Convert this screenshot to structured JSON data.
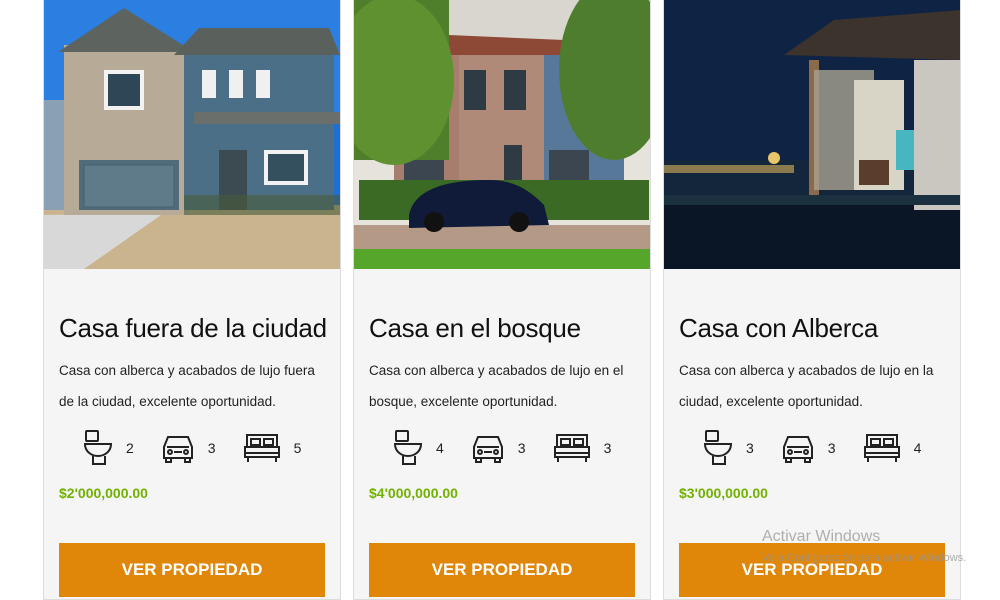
{
  "listings": [
    {
      "title": "Casa fuera de la ciudad",
      "description": "Casa con alberca y acabados de lujo fuera de la ciudad, excelente oportunidad.",
      "bathrooms": "2",
      "parking": "3",
      "bedrooms": "5",
      "price": "$2'000,000.00",
      "button_label": "VER PROPIEDAD"
    },
    {
      "title": "Casa en el bosque",
      "description": "Casa con alberca y acabados de lujo en el bosque, excelente oportunidad.",
      "bathrooms": "4",
      "parking": "3",
      "bedrooms": "3",
      "price": "$4'000,000.00",
      "button_label": "VER PROPIEDAD"
    },
    {
      "title": "Casa con Alberca",
      "description": "Casa con alberca y acabados de lujo en la ciudad, excelente oportunidad.",
      "bathrooms": "3",
      "parking": "3",
      "bedrooms": "4",
      "price": "$3'000,000.00",
      "button_label": "VER PROPIEDAD"
    }
  ],
  "icons": {
    "bathrooms": "toilet-icon",
    "parking": "car-icon",
    "bedrooms": "bed-icon"
  },
  "colors": {
    "price": "#71b100",
    "button": "#e08709",
    "card_background": "#f5f5f5"
  },
  "watermark": {
    "title": "Activar Windows",
    "subtitle": "Ve a Configuración para activar Windows."
  }
}
